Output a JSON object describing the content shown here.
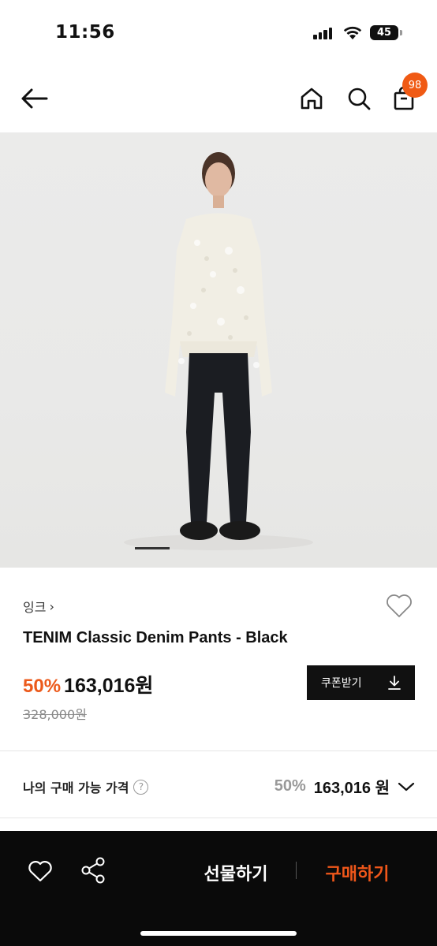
{
  "status_bar": {
    "time": "11:56",
    "battery": "45"
  },
  "nav": {
    "cart_count": "98"
  },
  "product": {
    "brand": "잉크",
    "brand_chevron": "›",
    "name": "TENIM Classic Denim Pants - Black",
    "discount": "50%",
    "sale_price": "163,016원",
    "original_price": "328,000원",
    "coupon_label": "쿠폰받기"
  },
  "my_price": {
    "label": "나의 구매 가능 가격",
    "help": "?",
    "discount": "50%",
    "price": "163,016 원"
  },
  "bottom_bar": {
    "gift_label": "선물하기",
    "buy_label": "구매하기"
  },
  "colors": {
    "accent": "#ec5a1b",
    "dark": "#0a0a0a",
    "badge": "#f05a14"
  },
  "icons": [
    "back-arrow-icon",
    "home-icon",
    "search-icon",
    "shopping-bag-icon",
    "heart-icon",
    "download-icon",
    "help-icon",
    "chevron-down-icon",
    "share-icon"
  ]
}
